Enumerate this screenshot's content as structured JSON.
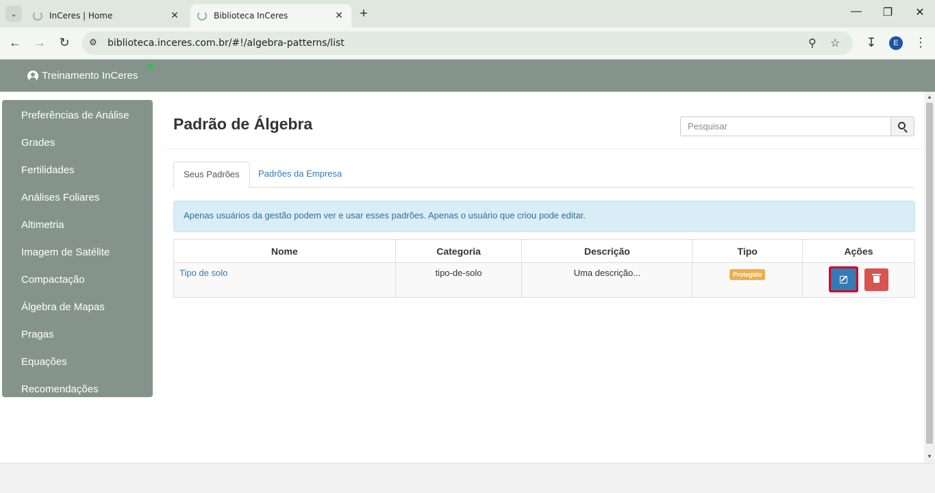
{
  "browser": {
    "tabs": [
      {
        "title": "InCeres | Home",
        "active": false
      },
      {
        "title": "Biblioteca InCeres",
        "active": true
      }
    ],
    "url": "biblioteca.inceres.com.br/#!/algebra-patterns/list",
    "profile_initial": "E"
  },
  "header": {
    "user_name": "Treinamento InCeres"
  },
  "sidebar": {
    "items": [
      {
        "label": "Preferências de Análise"
      },
      {
        "label": "Grades"
      },
      {
        "label": "Fertilidades"
      },
      {
        "label": "Análises Foliares"
      },
      {
        "label": "Altimetria"
      },
      {
        "label": "Imagem de Satélite"
      },
      {
        "label": "Compactação"
      },
      {
        "label": "Álgebra de Mapas"
      },
      {
        "label": "Pragas"
      },
      {
        "label": "Equações"
      },
      {
        "label": "Recomendações"
      }
    ]
  },
  "main": {
    "title": "Padrão de Álgebra",
    "search_placeholder": "Pesquisar",
    "tabs": [
      {
        "label": "Seus Padrões",
        "active": true
      },
      {
        "label": "Padrões da Empresa",
        "active": false
      }
    ],
    "info_alert": "Apenas usuários da gestão podem ver e usar esses padrões. Apenas o usuário que criou pode editar.",
    "table": {
      "columns": [
        "Nome",
        "Categoria",
        "Descrição",
        "Tipo",
        "Ações"
      ],
      "rows": [
        {
          "nome": "Tipo de solo",
          "categoria": "tipo-de-solo",
          "descricao": "Uma descrição...",
          "tipo": "Protegido"
        }
      ]
    }
  },
  "colors": {
    "header_bg": "#84948c",
    "link": "#337ab7",
    "edit_button": "#337ab7",
    "delete_button": "#d9534f",
    "badge": "#f0ad4e",
    "highlight_border": "#d6001c"
  }
}
